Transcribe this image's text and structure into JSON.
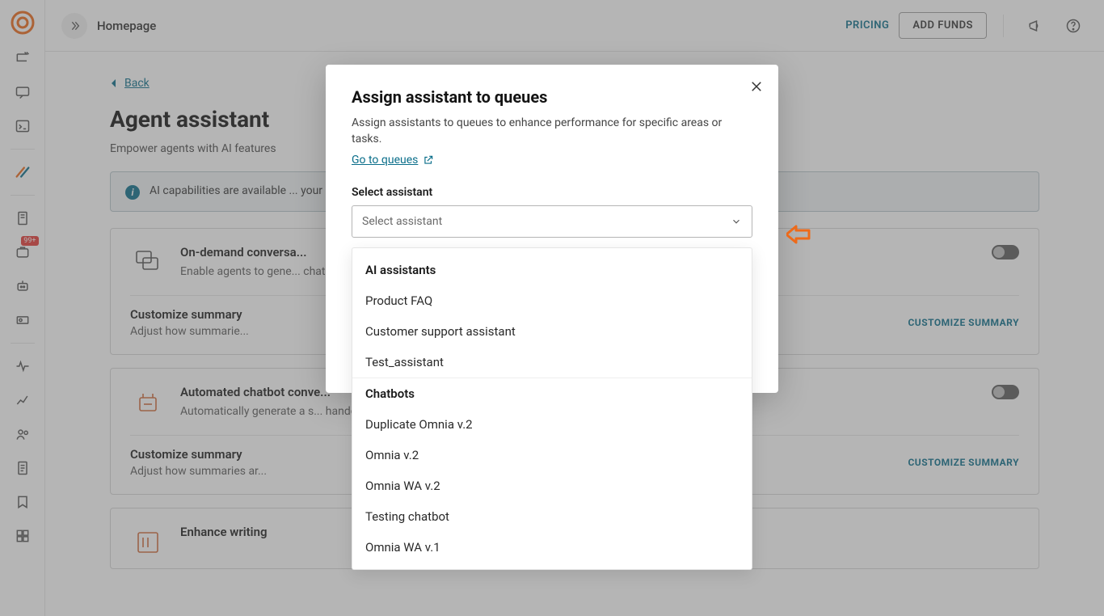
{
  "topbar": {
    "title": "Homepage",
    "pricing": "PRICING",
    "add_funds": "ADD FUNDS"
  },
  "sidebar": {
    "badge": "99+"
  },
  "page": {
    "back": "Back",
    "heading": "Agent assistant",
    "subtitle_visible": "Empower agents with AI features",
    "banner_visible": "AI capabilities are available ... your account manager or our support team."
  },
  "cards": [
    {
      "title_visible": "On-demand conversa...",
      "desc_visible": "Enable agents to gene... chatbot and agent int...",
      "sub_title": "Customize summary",
      "sub_desc_visible": "Adjust how summarie...",
      "customize": "CUSTOMIZE SUMMARY"
    },
    {
      "title_visible": "Automated chatbot conve...",
      "desc_visible": "Automatically generate a s... handoff. Chatbot summary",
      "sub_title": "Customize summary",
      "sub_desc_visible": "Adjust how summaries ar...",
      "customize": "CUSTOMIZE SUMMARY"
    },
    {
      "title_visible": "Enhance writing"
    }
  ],
  "modal": {
    "title": "Assign assistant to queues",
    "description": "Assign assistants to queues to enhance performance for specific areas or tasks.",
    "link": "Go to queues",
    "select_label": "Select assistant",
    "placeholder": "Select assistant"
  },
  "dropdown": {
    "group1": "AI assistants",
    "items1": [
      "Product FAQ",
      "Customer support assistant",
      "Test_assistant"
    ],
    "group2": "Chatbots",
    "items2": [
      "Duplicate Omnia v.2",
      "Omnia v.2",
      "Omnia WA v.2",
      "Testing chatbot",
      "Omnia WA v.1"
    ]
  }
}
